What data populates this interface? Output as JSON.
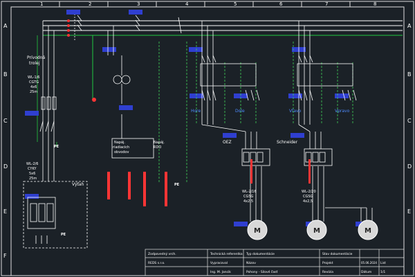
{
  "colors": {
    "background": "#1b2127",
    "wire": "#ffffff",
    "earth": "#22c940",
    "control": "#e9ee58",
    "dashed": "#43d35a",
    "label_bg": "#2f3fd0",
    "label_text": "#ff4040",
    "terminal": "#ff3535",
    "motor_fill": "#d8d8d8"
  },
  "frame": {
    "columns": [
      "1",
      "2",
      "3",
      "4",
      "5",
      "6",
      "7",
      "8"
    ],
    "rows": [
      "A",
      "B",
      "C",
      "D",
      "E",
      "F"
    ]
  },
  "labels": {
    "pracna_1": "Prívodná",
    "pracna_2": "trolej",
    "rozvody_1": "Napáj.",
    "rozvody_2": "riadiacich",
    "rozvody_3": "obvodov",
    "napaj_rdo_1": "Napáj.",
    "napaj_rdo_2": "RDO",
    "spark": "Výťah",
    "gez": "OEZ",
    "schneider": "Schneider",
    "k1": "Hore",
    "k2": "Dole",
    "k3": "Vľavo",
    "k4": "Vpravo",
    "pe1": "PE",
    "pe2": "PE",
    "pe3": "PE",
    "cable1_a": "WL-2/16",
    "cable1_b": "CGSG",
    "cable1_c": "4x2,5",
    "cable2_a": "WL-2/20",
    "cable2_b": "CGSG",
    "cable2_c": "4x2,5",
    "left_cable_a": "WL-1/6",
    "left_cable_b": "CGTG",
    "left_cable_c": "4x6",
    "left_cable_d": "25m",
    "left_cable2_a": "WL-2/6",
    "left_cable2_b": "CYKY",
    "left_cable2_c": "5x6",
    "left_cable2_d": "25m"
  },
  "title_block": {
    "zodpovedny": "Zodpovedný vrch.",
    "technicka": "Technická referentka",
    "typ": "Typ dokumentácie",
    "stav": "Stav dokumentácie",
    "firma": "REDS s.r.o.",
    "vypracoval": "Vypracoval",
    "meno": "Ing. M. Jancik",
    "nazov": "Názov",
    "nazov_val": "Pohony - Silové časť",
    "projekt": "Projekt",
    "reviz": "Revízia",
    "datum": "Dátum",
    "list": "List",
    "list_val": "1/1",
    "datum_val": "05.06.2024"
  }
}
